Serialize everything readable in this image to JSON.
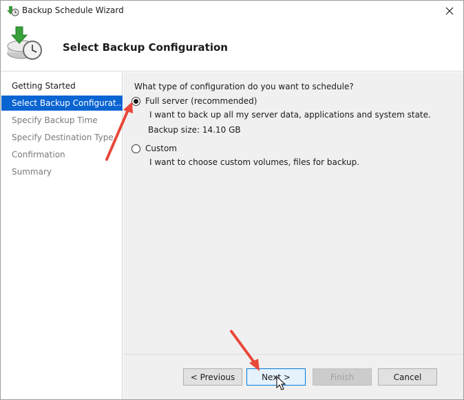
{
  "window": {
    "title": "Backup Schedule Wizard"
  },
  "header": {
    "title": "Select Backup Configuration"
  },
  "nav": {
    "items": [
      {
        "label": "Getting Started",
        "state": "done"
      },
      {
        "label": "Select Backup Configurat...",
        "state": "active"
      },
      {
        "label": "Specify Backup Time",
        "state": "disabled"
      },
      {
        "label": "Specify Destination Type",
        "state": "disabled"
      },
      {
        "label": "Confirmation",
        "state": "disabled"
      },
      {
        "label": "Summary",
        "state": "disabled"
      }
    ]
  },
  "content": {
    "question": "What type of configuration do you want to schedule?",
    "options": [
      {
        "label": "Full server (recommended)",
        "description": "I want to back up all my server data, applications and system state.",
        "size": "Backup size: 14.10 GB",
        "checked": true
      },
      {
        "label": "Custom",
        "description": "I want to choose custom volumes, files for backup.",
        "checked": false
      }
    ]
  },
  "buttons": {
    "previous": "< Previous",
    "next": "Next >",
    "finish": "Finish",
    "cancel": "Cancel"
  },
  "colors": {
    "accent": "#0a64d2",
    "annotation": "#e8473a"
  },
  "icons": {
    "title": "backup-clock-icon",
    "header": "backup-disc-icon",
    "close": "close-icon"
  }
}
